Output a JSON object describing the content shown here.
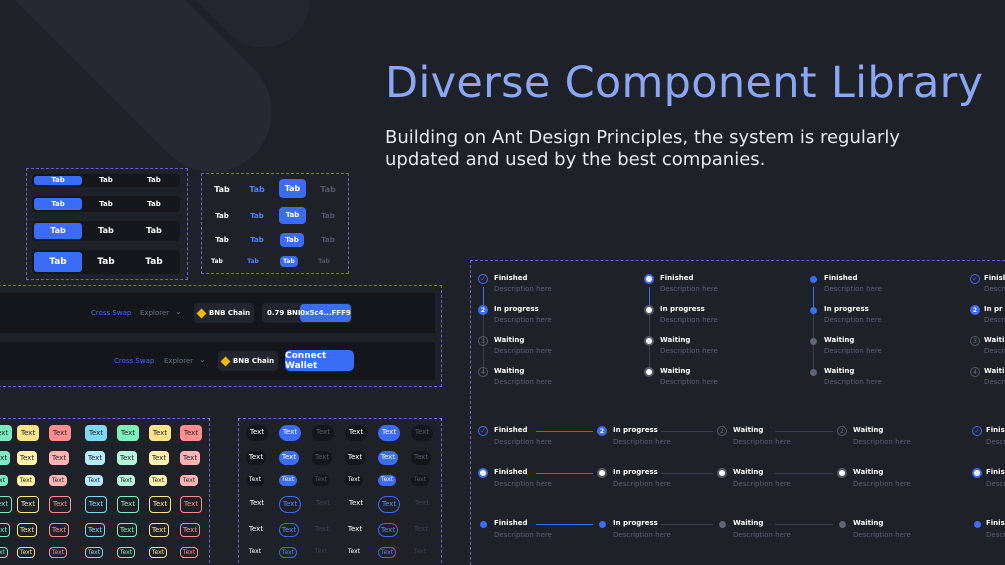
{
  "hero": {
    "title": "Diverse Component Library",
    "subtitle": "Building on Ant Design Principles, the system is regularly updated and used by the best companies."
  },
  "tabs": {
    "active": "Tab",
    "item": "Tab"
  },
  "toolbar": {
    "cross_swap": "Cross Swap",
    "explorer": "Explorer",
    "chain": "BNB Chain",
    "balance": "0.79 BNB",
    "address": "0x5c4...FFF9",
    "connect": "Connect Wallet"
  },
  "badges": {
    "text": "Text"
  },
  "steps": {
    "finished": "Finished",
    "in_progress": "In progress",
    "waiting": "Waiting",
    "description": "Description here",
    "n2": "2",
    "n3": "3",
    "n4": "4",
    "truncated": {
      "finished": "Finishe",
      "description": "Descri",
      "in_progress": "In pr",
      "waiting": "Waiti"
    }
  },
  "colors": {
    "accent": "#3b6cf5",
    "hero_title": "#8aa7f5",
    "dashed_border": "#6e5fc9",
    "background": "#1f2129"
  }
}
